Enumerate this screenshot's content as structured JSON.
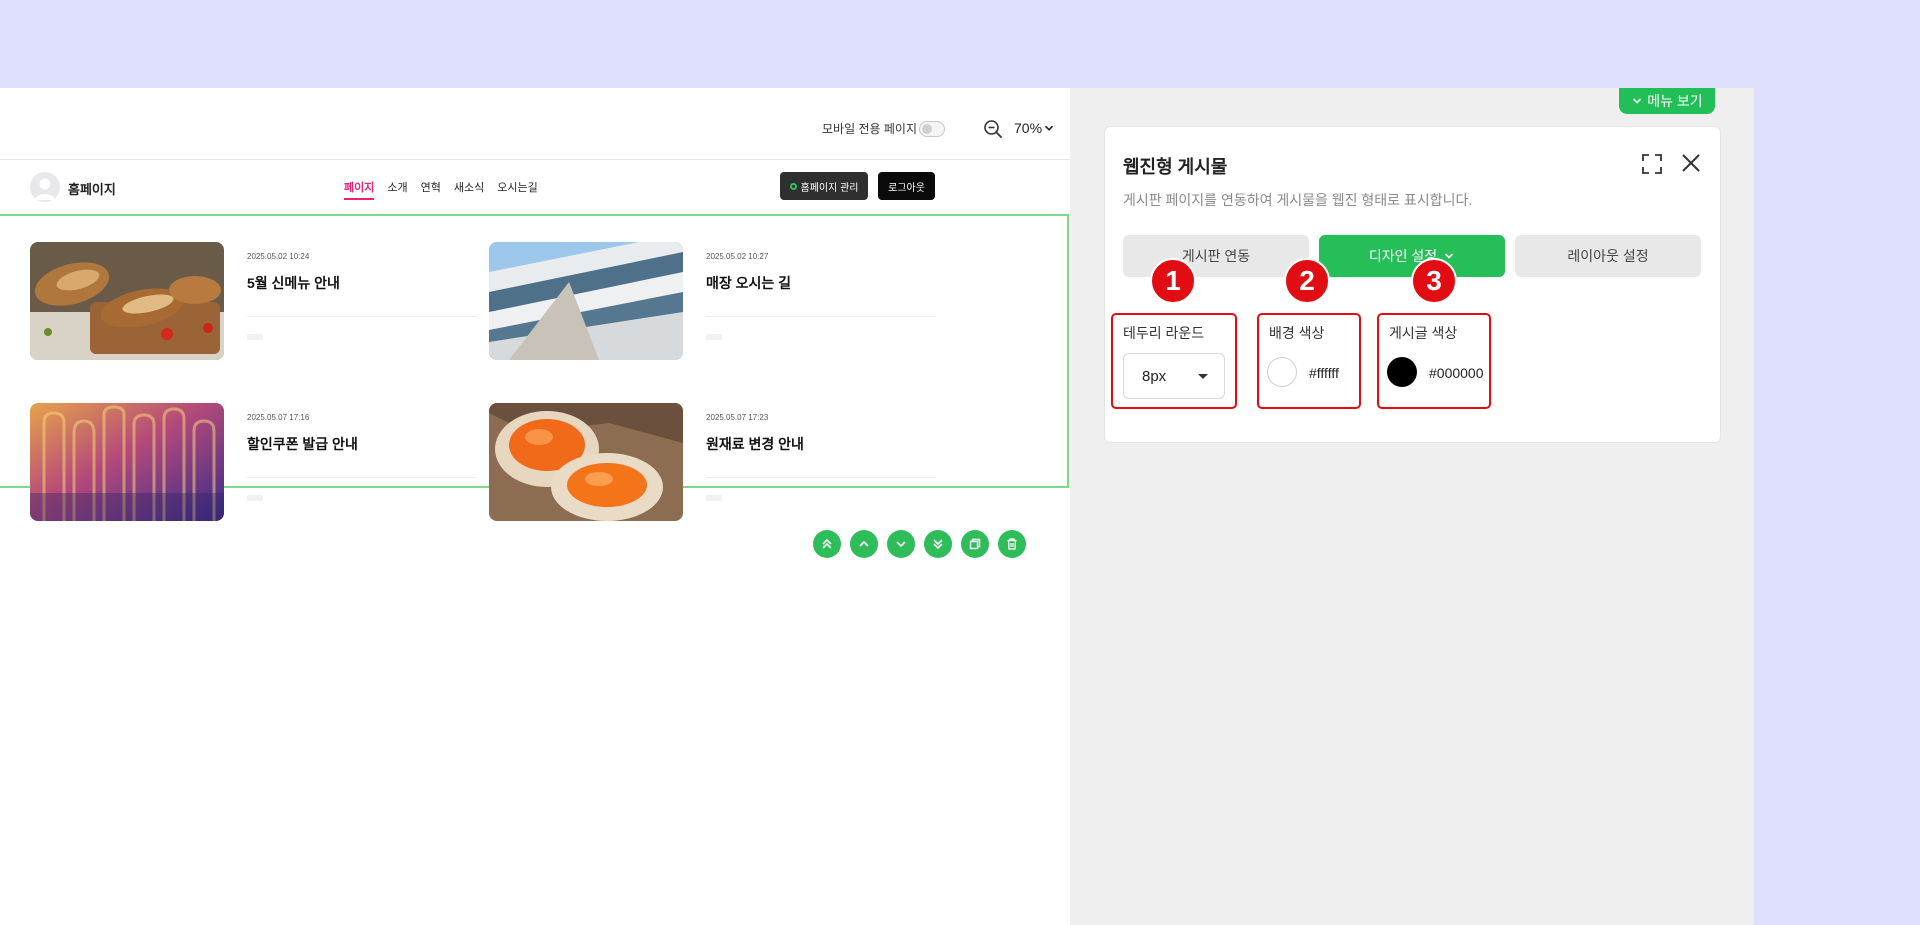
{
  "preview": {
    "mobile_only_label": "모바일 전용 페이지",
    "zoom_value": "70%",
    "site": {
      "brand": "홈페이지",
      "nav": [
        "페이지",
        "소개",
        "연혁",
        "새소식",
        "오시는길"
      ],
      "active_nav": "페이지",
      "manage_label": "홈페이지 관리",
      "logout_label": "로그아웃"
    },
    "posts": [
      {
        "date": "2025.05.02 10:24",
        "title": "5월 신메뉴 안내"
      },
      {
        "date": "2025.05.02 10:27",
        "title": "매장 오시는 길"
      },
      {
        "date": "2025.05.07 17:16",
        "title": "할인쿠폰 발급 안내"
      },
      {
        "date": "2025.05.07 17:23",
        "title": "원재료 변경 안내"
      }
    ]
  },
  "settings": {
    "menu_view_label": "메뉴 보기",
    "panel_title": "웹진형 게시물",
    "panel_desc": "게시판 페이지를 연동하여 게시물을 웹진 형태로 표시합니다.",
    "tabs": {
      "board_link": "게시판 연동",
      "design": "디자인 설정",
      "layout": "레이아웃 설정"
    },
    "border_radius": {
      "label": "테두리 라운드",
      "value": "8px"
    },
    "bg_color": {
      "label": "배경 색상",
      "value": "#ffffff"
    },
    "post_color": {
      "label": "게시글 색상",
      "value": "#000000"
    },
    "badges": [
      "1",
      "2",
      "3"
    ]
  },
  "colors": {
    "accent_green": "#26be58",
    "highlight_red": "#e10d13",
    "nav_active": "#e4247a"
  }
}
